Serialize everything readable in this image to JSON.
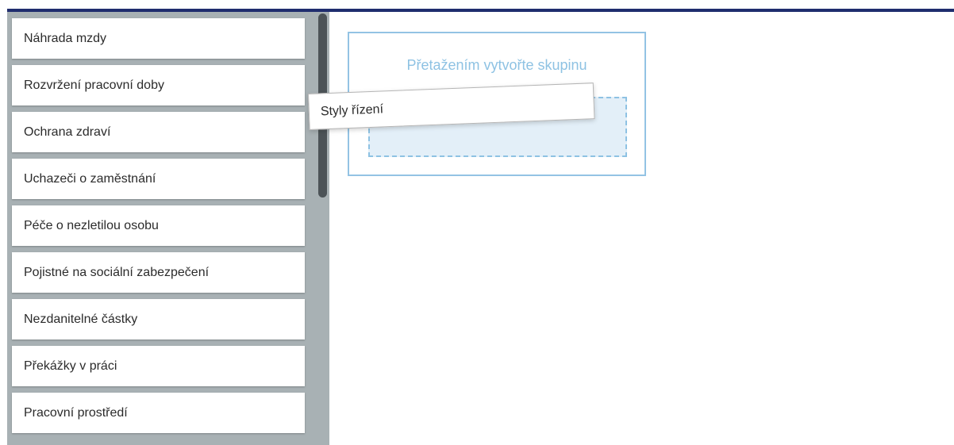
{
  "sidebar": {
    "items": [
      {
        "label": "Náhrada mzdy"
      },
      {
        "label": "Rozvržení pracovní doby"
      },
      {
        "label": "Ochrana zdraví"
      },
      {
        "label": "Uchazeči o zaměstnání"
      },
      {
        "label": "Péče o nezletilou osobu"
      },
      {
        "label": "Pojistné na sociální zabezpečení"
      },
      {
        "label": "Nezdanitelné částky"
      },
      {
        "label": "Překážky v práci"
      },
      {
        "label": "Pracovní prostředí"
      }
    ]
  },
  "drop_zone": {
    "title": "Přetažením vytvořte skupinu"
  },
  "dragged_item": {
    "label": "Styly řízení"
  },
  "colors": {
    "top_bar": "#1f2d6e",
    "sidebar_bg": "#a8b1b4",
    "accent": "#8ec2e3"
  }
}
